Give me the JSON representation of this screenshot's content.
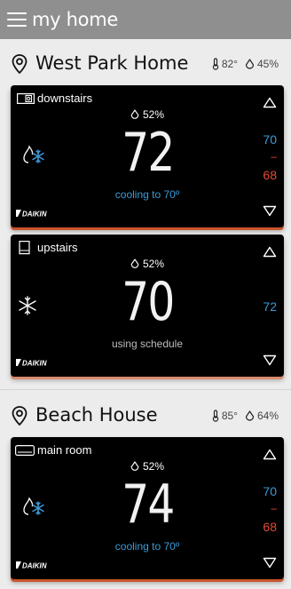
{
  "app": {
    "title": "my home"
  },
  "homes": [
    {
      "name": "West Park Home",
      "outdoor_temp": "82°",
      "outdoor_humidity": "45%",
      "zones": [
        {
          "name": "downstairs",
          "humidity": "52%",
          "temperature": "72",
          "status": "cooling to 70º",
          "cool_setpoint": "70",
          "separator": "–",
          "heat_setpoint": "68",
          "brand": "DAIKIN",
          "mode_icon": "heat-cool-icon"
        },
        {
          "name": "upstairs",
          "humidity": "52%",
          "temperature": "70",
          "status": "using schedule",
          "cool_setpoint": "72",
          "brand": "DAIKIN",
          "mode_icon": "snowflake-icon"
        }
      ]
    },
    {
      "name": "Beach House",
      "outdoor_temp": "85°",
      "outdoor_humidity": "64%",
      "zones": [
        {
          "name": "main room",
          "humidity": "52%",
          "temperature": "74",
          "status": "cooling to 70º",
          "cool_setpoint": "70",
          "separator": "–",
          "heat_setpoint": "68",
          "brand": "DAIKIN",
          "mode_icon": "heat-cool-icon"
        }
      ]
    }
  ],
  "colors": {
    "cool": "#3d9ad8",
    "heat": "#e54a35",
    "header": "#8f8f8f",
    "card_glow": "#c9542c"
  }
}
